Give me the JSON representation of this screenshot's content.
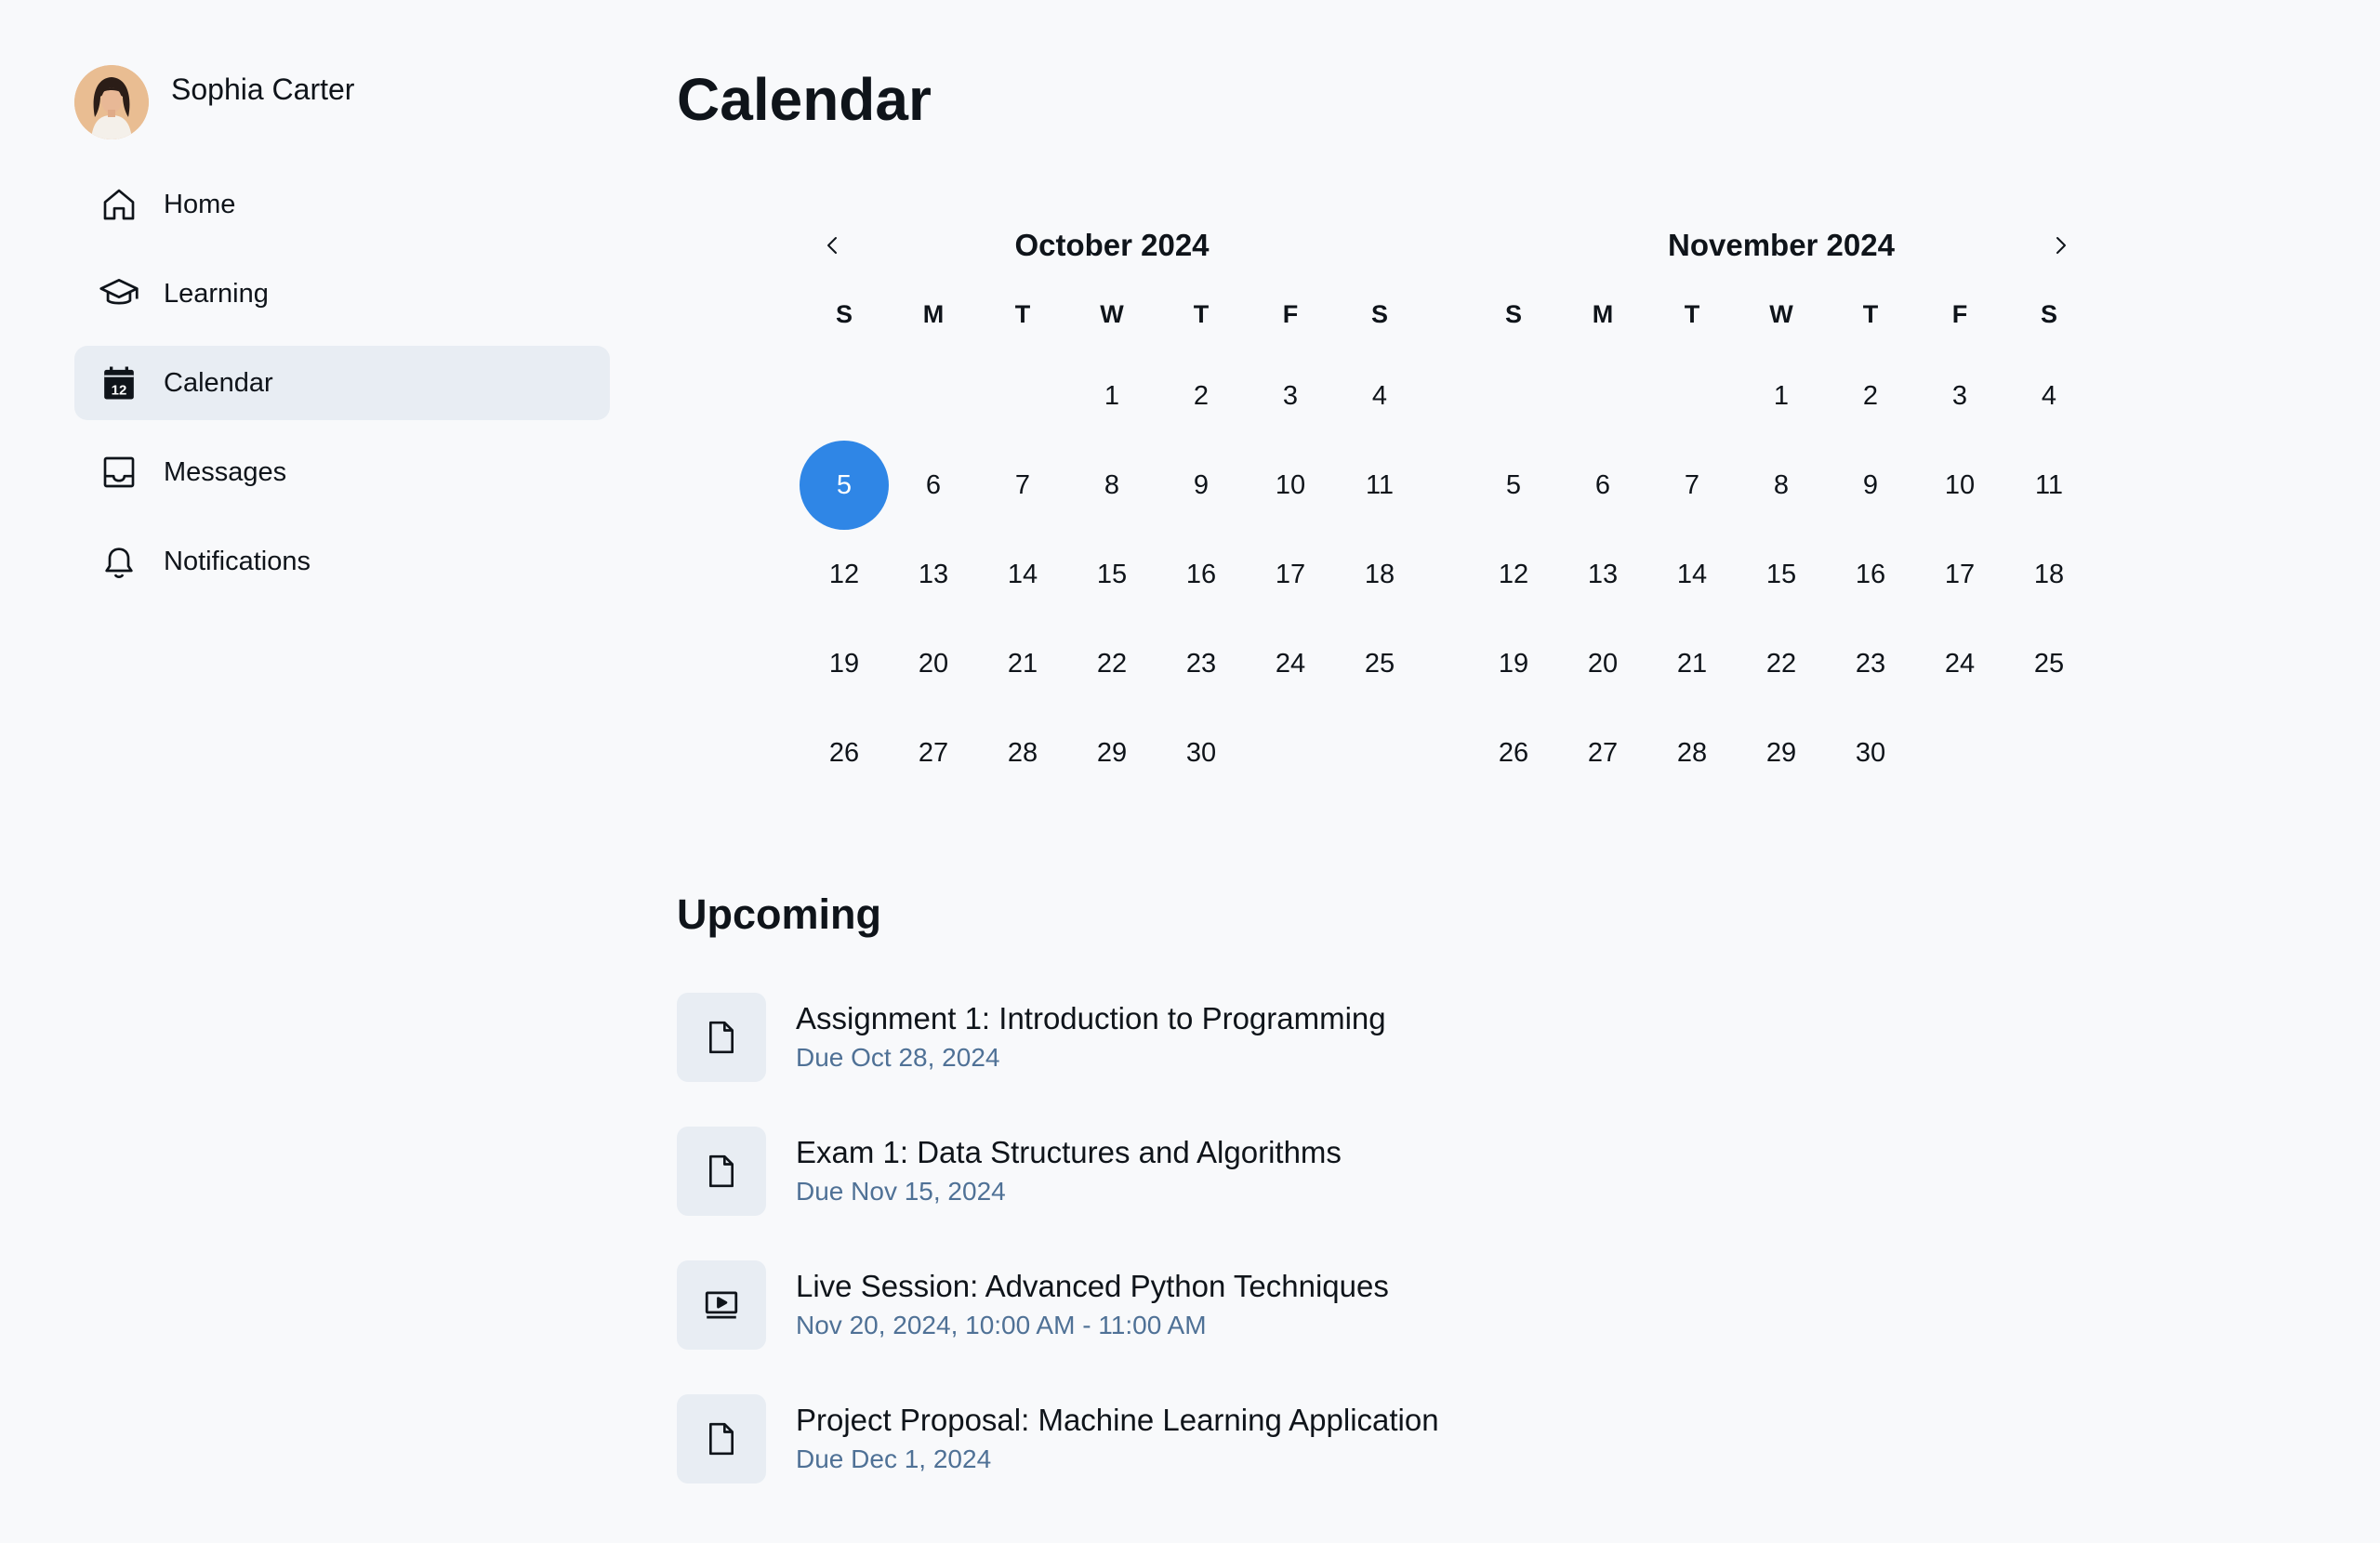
{
  "user": {
    "name": "Sophia Carter"
  },
  "sidebar": {
    "items": [
      {
        "label": "Home",
        "icon": "home-icon",
        "active": false
      },
      {
        "label": "Learning",
        "icon": "graduation-cap-icon",
        "active": false
      },
      {
        "label": "Calendar",
        "icon": "calendar-icon",
        "active": true,
        "icon_text": "12"
      },
      {
        "label": "Messages",
        "icon": "inbox-icon",
        "active": false
      },
      {
        "label": "Notifications",
        "icon": "bell-icon",
        "active": false
      }
    ]
  },
  "page": {
    "title": "Calendar"
  },
  "weekdays": [
    "S",
    "M",
    "T",
    "W",
    "T",
    "F",
    "S"
  ],
  "calendars": [
    {
      "title": "October 2024",
      "lead_blanks": 3,
      "days": 30,
      "selected_day": 5,
      "nav": "prev-arrow-icon"
    },
    {
      "title": "November 2024",
      "lead_blanks": 3,
      "days": 30,
      "selected_day": null,
      "nav": "next-arrow-icon"
    }
  ],
  "upcoming": {
    "title": "Upcoming",
    "items": [
      {
        "title": "Assignment 1: Introduction to Programming",
        "subtitle": "Due Oct 28, 2024",
        "icon": "document-icon"
      },
      {
        "title": "Exam 1: Data Structures and Algorithms",
        "subtitle": "Due Nov 15, 2024",
        "icon": "document-icon"
      },
      {
        "title": "Live Session: Advanced Python Techniques",
        "subtitle": "Nov 20, 2024, 10:00 AM - 11:00 AM",
        "icon": "video-icon"
      },
      {
        "title": "Project Proposal: Machine Learning Application",
        "subtitle": "Due Dec 1, 2024",
        "icon": "document-icon"
      }
    ]
  },
  "colors": {
    "accent": "#2f86e6",
    "active_nav_bg": "#e8edf3",
    "subtitle_text": "#4f7196",
    "background": "#f8f9fb"
  }
}
